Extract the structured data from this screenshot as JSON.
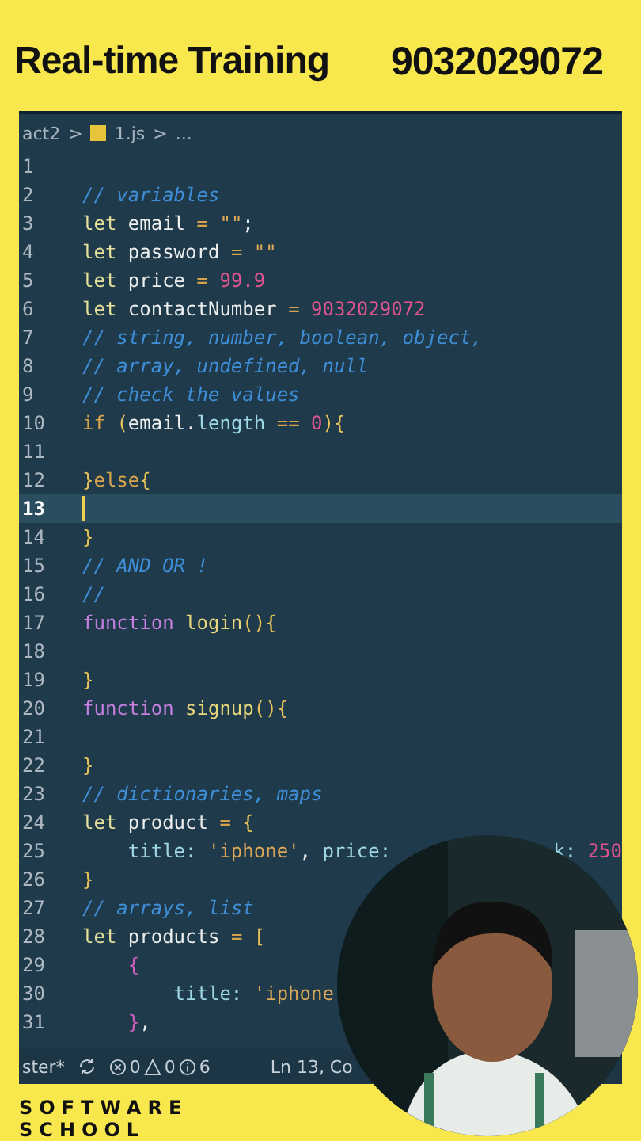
{
  "header": {
    "title": "Real-time Training",
    "phone": "9032029072"
  },
  "breadcrumb": {
    "folder": "act2",
    "separator": ">",
    "file": "1.js",
    "more": "..."
  },
  "lines": [
    {
      "number": "1",
      "current": false
    },
    {
      "number": "2",
      "current": false,
      "tokens": [
        {
          "kind": "cm",
          "text": "// variables"
        }
      ]
    },
    {
      "number": "3",
      "current": false,
      "tokens": [
        {
          "kind": "kw",
          "text": "let "
        },
        {
          "kind": "var",
          "text": "email "
        },
        {
          "kind": "op",
          "text": "= "
        },
        {
          "kind": "str",
          "text": "\"\""
        },
        {
          "kind": "var",
          "text": ";"
        }
      ]
    },
    {
      "number": "4",
      "current": false,
      "tokens": [
        {
          "kind": "kw",
          "text": "let "
        },
        {
          "kind": "var",
          "text": "password "
        },
        {
          "kind": "op",
          "text": "= "
        },
        {
          "kind": "str",
          "text": "\"\""
        }
      ]
    },
    {
      "number": "5",
      "current": false,
      "tokens": [
        {
          "kind": "kw",
          "text": "let "
        },
        {
          "kind": "var",
          "text": "price "
        },
        {
          "kind": "op",
          "text": "= "
        },
        {
          "kind": "num",
          "text": "99.9"
        }
      ]
    },
    {
      "number": "6",
      "current": false,
      "tokens": [
        {
          "kind": "kw",
          "text": "let "
        },
        {
          "kind": "var",
          "text": "contactNumber "
        },
        {
          "kind": "op",
          "text": "= "
        },
        {
          "kind": "num",
          "text": "9032029072"
        }
      ]
    },
    {
      "number": "7",
      "current": false,
      "tokens": [
        {
          "kind": "cm",
          "text": "// string, number, boolean, object,"
        }
      ]
    },
    {
      "number": "8",
      "current": false,
      "tokens": [
        {
          "kind": "cm",
          "text": "// array, undefined, null"
        }
      ]
    },
    {
      "number": "9",
      "current": false,
      "tokens": [
        {
          "kind": "cm",
          "text": "// check the values"
        }
      ]
    },
    {
      "number": "10",
      "current": false,
      "tokens": [
        {
          "kind": "ctl",
          "text": "if "
        },
        {
          "kind": "br",
          "text": "("
        },
        {
          "kind": "var",
          "text": "email."
        },
        {
          "kind": "prop",
          "text": "length "
        },
        {
          "kind": "op",
          "text": "== "
        },
        {
          "kind": "num",
          "text": "0"
        },
        {
          "kind": "br",
          "text": "){"
        }
      ]
    },
    {
      "number": "11",
      "current": false
    },
    {
      "number": "12",
      "current": false,
      "tokens": [
        {
          "kind": "br",
          "text": "}"
        },
        {
          "kind": "ctl",
          "text": "else"
        },
        {
          "kind": "br",
          "text": "{"
        }
      ]
    },
    {
      "number": "13",
      "current": true
    },
    {
      "number": "14",
      "current": false,
      "tokens": [
        {
          "kind": "br",
          "text": "}"
        }
      ]
    },
    {
      "number": "15",
      "current": false,
      "tokens": [
        {
          "kind": "cm",
          "text": "// AND OR !"
        }
      ]
    },
    {
      "number": "16",
      "current": false,
      "tokens": [
        {
          "kind": "cm",
          "text": "//"
        }
      ]
    },
    {
      "number": "17",
      "current": false,
      "tokens": [
        {
          "kind": "fnkw",
          "text": "function "
        },
        {
          "kind": "fn",
          "text": "login"
        },
        {
          "kind": "br",
          "text": "(){"
        }
      ]
    },
    {
      "number": "18",
      "current": false
    },
    {
      "number": "19",
      "current": false,
      "tokens": [
        {
          "kind": "br",
          "text": "}"
        }
      ]
    },
    {
      "number": "20",
      "current": false,
      "tokens": [
        {
          "kind": "fnkw",
          "text": "function "
        },
        {
          "kind": "fn",
          "text": "signup"
        },
        {
          "kind": "br",
          "text": "(){"
        }
      ]
    },
    {
      "number": "21",
      "current": false
    },
    {
      "number": "22",
      "current": false,
      "tokens": [
        {
          "kind": "br",
          "text": "}"
        }
      ]
    },
    {
      "number": "23",
      "current": false,
      "tokens": [
        {
          "kind": "cm",
          "text": "// dictionaries, maps"
        }
      ]
    },
    {
      "number": "24",
      "current": false,
      "tokens": [
        {
          "kind": "kw",
          "text": "let "
        },
        {
          "kind": "var",
          "text": "product "
        },
        {
          "kind": "op",
          "text": "= "
        },
        {
          "kind": "br",
          "text": "{"
        }
      ]
    },
    {
      "number": "25",
      "current": false,
      "tokens": [
        {
          "kind": "prop",
          "text": "    title: "
        },
        {
          "kind": "str",
          "text": "'iphone'"
        },
        {
          "kind": "var",
          "text": ", "
        },
        {
          "kind": "prop",
          "text": "price:"
        }
      ],
      "tail": [
        {
          "kind": "prop",
          "text": "k: "
        },
        {
          "kind": "num",
          "text": "250"
        }
      ]
    },
    {
      "number": "26",
      "current": false,
      "tokens": [
        {
          "kind": "br",
          "text": "}"
        }
      ]
    },
    {
      "number": "27",
      "current": false,
      "tokens": [
        {
          "kind": "cm",
          "text": "// arrays, list"
        }
      ]
    },
    {
      "number": "28",
      "current": false,
      "tokens": [
        {
          "kind": "kw",
          "text": "let "
        },
        {
          "kind": "var",
          "text": "products "
        },
        {
          "kind": "op",
          "text": "= "
        },
        {
          "kind": "br",
          "text": "["
        }
      ]
    },
    {
      "number": "29",
      "current": false,
      "tokens": [
        {
          "kind": "br2",
          "text": "    {"
        }
      ]
    },
    {
      "number": "30",
      "current": false,
      "tokens": [
        {
          "kind": "prop",
          "text": "        title: "
        },
        {
          "kind": "str",
          "text": "'iphone"
        }
      ]
    },
    {
      "number": "31",
      "current": false,
      "tokens": [
        {
          "kind": "br2",
          "text": "    }"
        },
        {
          "kind": "var",
          "text": ","
        }
      ]
    }
  ],
  "status_bar": {
    "branch": "ster*",
    "errors": "0",
    "warnings": "0",
    "infos": "6",
    "position": "Ln 13, Co"
  },
  "footer": {
    "line_1": "SOFTWARE",
    "line_2": "SCHOOL"
  }
}
